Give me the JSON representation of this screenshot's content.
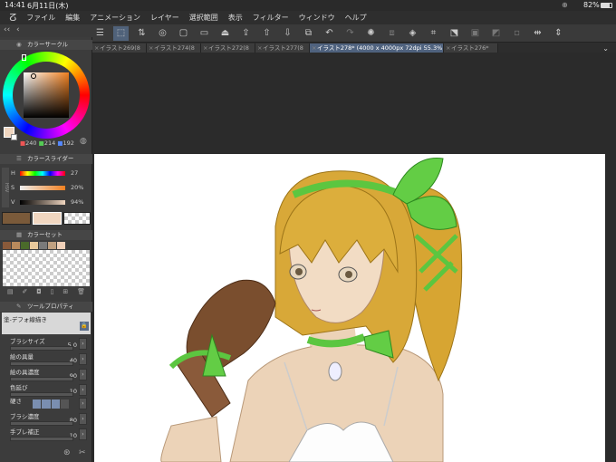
{
  "status": {
    "time": "14:41",
    "date": "6月11日(木)",
    "battery": "82%"
  },
  "menu": [
    "ファイル",
    "編集",
    "アニメーション",
    "レイヤー",
    "選択範囲",
    "表示",
    "フィルター",
    "ウィンドウ",
    "ヘルプ"
  ],
  "tabs": [
    {
      "label": "イラスト269(8"
    },
    {
      "label": "イラスト274(8"
    },
    {
      "label": "イラスト272(8"
    },
    {
      "label": "イラスト277(8"
    },
    {
      "label": "イラスト278* (4000 x 4000px 72dpi 55.3%)",
      "active": true
    },
    {
      "label": "イラスト276*"
    }
  ],
  "color_wheel": {
    "title": "カラーサークル",
    "r": "240",
    "g": "214",
    "b": "192"
  },
  "color_slider": {
    "title": "カラースライダー",
    "h_label": "H",
    "h": "27",
    "s_label": "S",
    "s": "20%",
    "v_label": "V",
    "v": "94%",
    "mode": "HSV"
  },
  "color_set": {
    "title": "カラーセット",
    "swatches": [
      "#8a5a3a",
      "#b98a5c",
      "#4a6a2a",
      "#e8c89a",
      "#7a7a7a",
      "#c0a080",
      "#f0d0b8"
    ]
  },
  "tool_property": {
    "title": "ツールプロパティ",
    "tool_name": "塗-デフォ線描き",
    "rows": [
      {
        "name": "ブラシサイズ",
        "value": "5.0"
      },
      {
        "name": "絵の具量",
        "value": "40"
      },
      {
        "name": "絵の具濃度",
        "value": "90"
      },
      {
        "name": "色延び",
        "value": "10"
      },
      {
        "name": "硬さ",
        "value": ""
      },
      {
        "name": "ブラシ濃度",
        "value": "80"
      },
      {
        "name": "手ブレ補正",
        "value": "10"
      }
    ]
  },
  "colors": {
    "main": "#f0d6c0",
    "accent": "#50627a"
  }
}
